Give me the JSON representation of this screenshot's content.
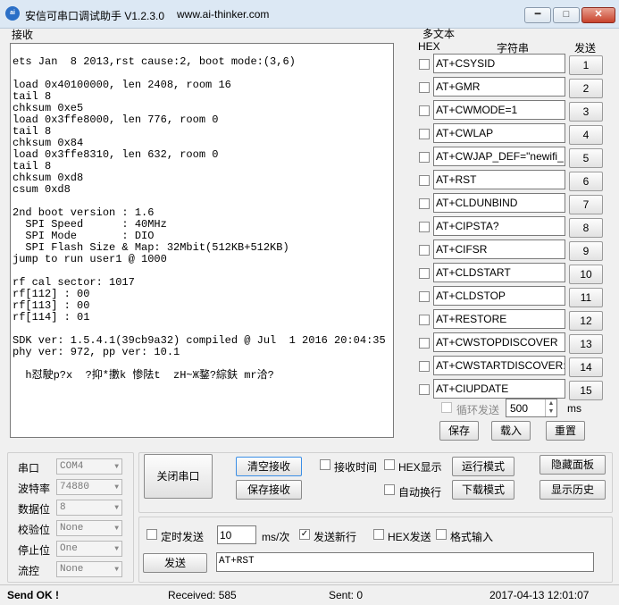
{
  "window": {
    "title": "安信可串口调试助手 V1.2.3.0",
    "url": "www.ai-thinker.com",
    "icon_text": "ai",
    "controls": {
      "minimize": "━",
      "maximize": "□",
      "close": "✕"
    }
  },
  "receive": {
    "label": "接收",
    "text": "ets Jan  8 2013,rst cause:2, boot mode:(3,6)\n\nload 0x40100000, len 2408, room 16\ntail 8\nchksum 0xe5\nload 0x3ffe8000, len 776, room 0\ntail 8\nchksum 0x84\nload 0x3ffe8310, len 632, room 0\ntail 8\nchksum 0xd8\ncsum 0xd8\n\n2nd boot version : 1.6\n  SPI Speed      : 40MHz\n  SPI Mode       : DIO\n  SPI Flash Size & Map: 32Mbit(512KB+512KB)\njump to run user1 @ 1000\n\nrf cal sector: 1017\nrf[112] : 00\nrf[113] : 00\nrf[114] : 01\n\nSDK ver: 1.5.4.1(39cb9a32) compiled @ Jul  1 2016 20:04:35\nphy ver: 972, pp ver: 10.1\n\n  h怼駛p?x  ?抑*擻k 惨阹t  zH~Ж鍪?綜鈇 mr洽?"
  },
  "multi": {
    "label": "多文本",
    "col_hex": "HEX",
    "col_str": "字符串",
    "col_send": "发送",
    "rows": [
      {
        "text": "AT+CSYSID",
        "num": "1"
      },
      {
        "text": "AT+GMR",
        "num": "2"
      },
      {
        "text": "AT+CWMODE=1",
        "num": "3"
      },
      {
        "text": "AT+CWLAP",
        "num": "4"
      },
      {
        "text": "AT+CWJAP_DEF=\"newifi_",
        "num": "5"
      },
      {
        "text": "AT+RST",
        "num": "6"
      },
      {
        "text": "AT+CLDUNBIND",
        "num": "7"
      },
      {
        "text": "AT+CIPSTA?",
        "num": "8"
      },
      {
        "text": "AT+CIFSR",
        "num": "9"
      },
      {
        "text": "AT+CLDSTART",
        "num": "10"
      },
      {
        "text": "AT+CLDSTOP",
        "num": "11"
      },
      {
        "text": "AT+RESTORE",
        "num": "12"
      },
      {
        "text": "AT+CWSTOPDISCOVER",
        "num": "13"
      },
      {
        "text": "AT+CWSTARTDISCOVER:",
        "num": "14"
      },
      {
        "text": "AT+CIUPDATE",
        "num": "15"
      }
    ],
    "loop_label": "循环发送",
    "loop_value": "500",
    "loop_unit": "ms",
    "save": "保存",
    "load": "载入",
    "reset": "重置"
  },
  "serial": {
    "port_label": "串口",
    "port_value": "COM4",
    "baud_label": "波特率",
    "baud_value": "74880",
    "data_label": "数据位",
    "data_value": "8",
    "parity_label": "校验位",
    "parity_value": "None",
    "stop_label": "停止位",
    "stop_value": "One",
    "flow_label": "流控",
    "flow_value": "None"
  },
  "controls": {
    "close_port": "关闭串口",
    "clear_recv": "清空接收",
    "save_recv": "保存接收",
    "recv_time": "接收时间",
    "hex_show": "HEX显示",
    "auto_wrap": "自动换行",
    "run_mode": "运行模式",
    "download_mode": "下载模式",
    "hide_panel": "隐藏面板",
    "show_history": "显示历史"
  },
  "send": {
    "timed_label": "定时发送",
    "interval_value": "10",
    "interval_unit": "ms/次",
    "newline_label": "发送新行",
    "hex_send_label": "HEX发送",
    "format_label": "格式输入",
    "send_button": "发送",
    "input_value": "AT+RST"
  },
  "status": {
    "state": "Send OK !",
    "received": "Received: 585",
    "sent": "Sent: 0",
    "datetime": "2017-04-13 12:01:07"
  }
}
